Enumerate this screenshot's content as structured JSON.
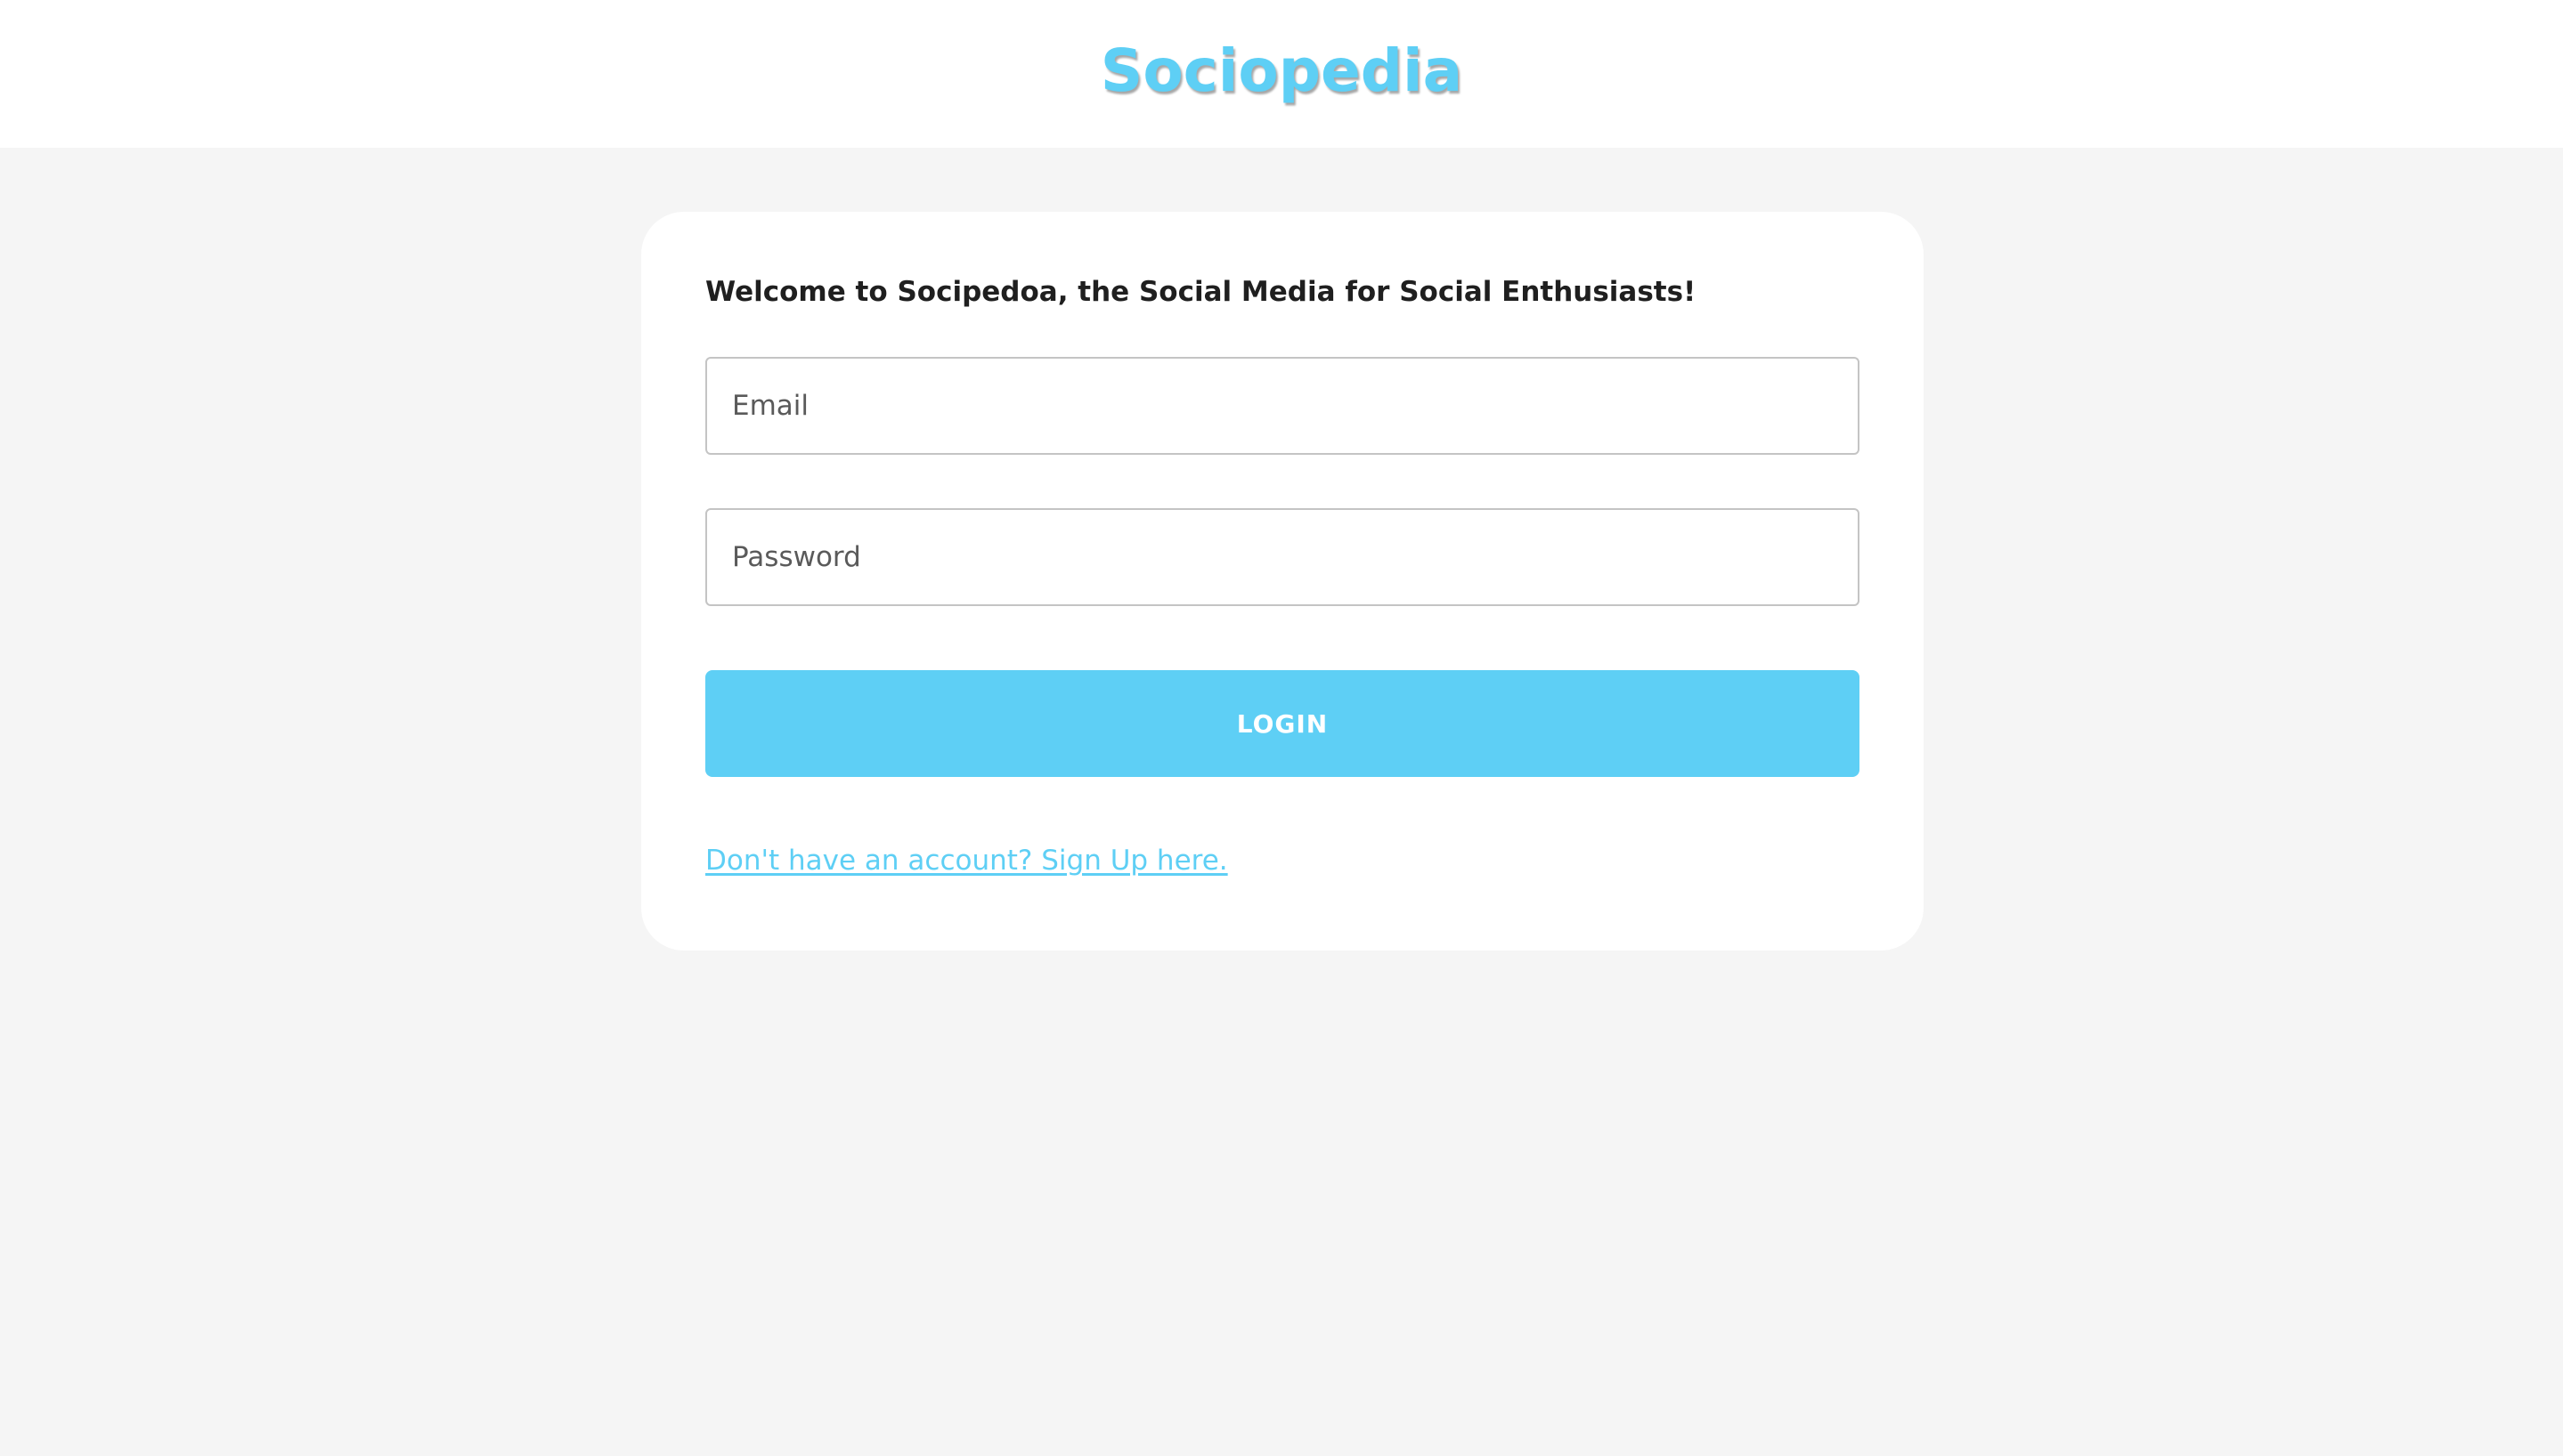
{
  "header": {
    "brand": "Sociopedia"
  },
  "login_card": {
    "welcome_text": "Welcome to Socipedoa, the Social Media for Social Enthusiasts!",
    "email": {
      "placeholder": "Email",
      "value": ""
    },
    "password": {
      "placeholder": "Password",
      "value": ""
    },
    "login_label": "LOGIN",
    "signup_link": "Don't have an account? Sign Up here."
  },
  "colors": {
    "accent": "#5ecff5",
    "background": "#f5f5f5",
    "card": "#ffffff",
    "text": "#1f1f1f"
  }
}
